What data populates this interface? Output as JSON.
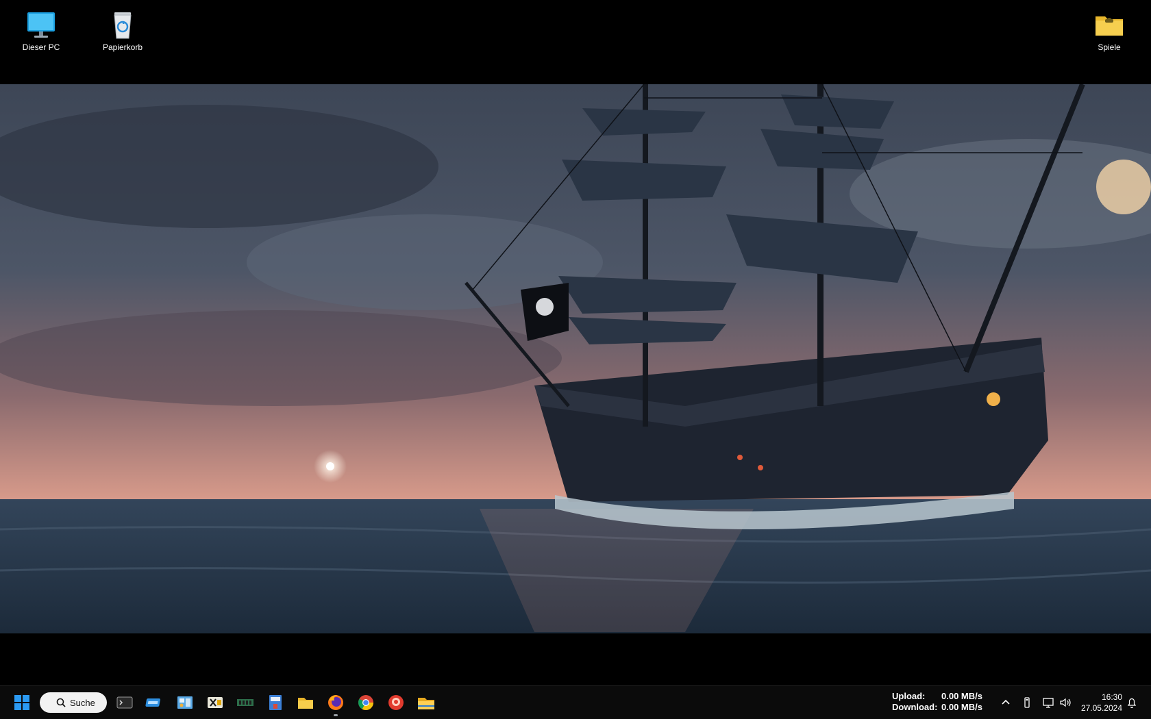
{
  "desktop": {
    "icons": [
      {
        "label": "Dieser PC",
        "icon": "monitor-icon"
      },
      {
        "label": "Papierkorb",
        "icon": "recycle-bin-icon"
      },
      {
        "label": "Spiele",
        "icon": "folder-icon"
      }
    ]
  },
  "taskbar": {
    "search": {
      "label": "Suche",
      "icon": "search-icon"
    },
    "apps": [
      {
        "name": "terminal",
        "icon": "terminal-icon"
      },
      {
        "name": "virtual-drive",
        "icon": "drive-icon"
      },
      {
        "name": "control-panel",
        "icon": "control-panel-icon"
      },
      {
        "name": "xodo",
        "icon": "x-app-icon"
      },
      {
        "name": "memory-monitor",
        "icon": "ram-icon"
      },
      {
        "name": "id-app",
        "icon": "id-app-icon"
      },
      {
        "name": "folder",
        "icon": "folder-icon"
      },
      {
        "name": "firefox",
        "icon": "firefox-icon"
      },
      {
        "name": "chrome",
        "icon": "chrome-icon"
      },
      {
        "name": "red-app",
        "icon": "red-circle-icon"
      },
      {
        "name": "file-explorer",
        "icon": "file-explorer-icon"
      }
    ],
    "network": {
      "upload_label": "Upload:",
      "upload_value": "0.00 MB/s",
      "download_label": "Download:",
      "download_value": "0.00 MB/s"
    },
    "clock": {
      "time": "16:30",
      "date": "27.05.2024"
    }
  },
  "colors": {
    "taskbar_bg": "#0b0b0b",
    "windows_blue": "#1f8ef1"
  }
}
